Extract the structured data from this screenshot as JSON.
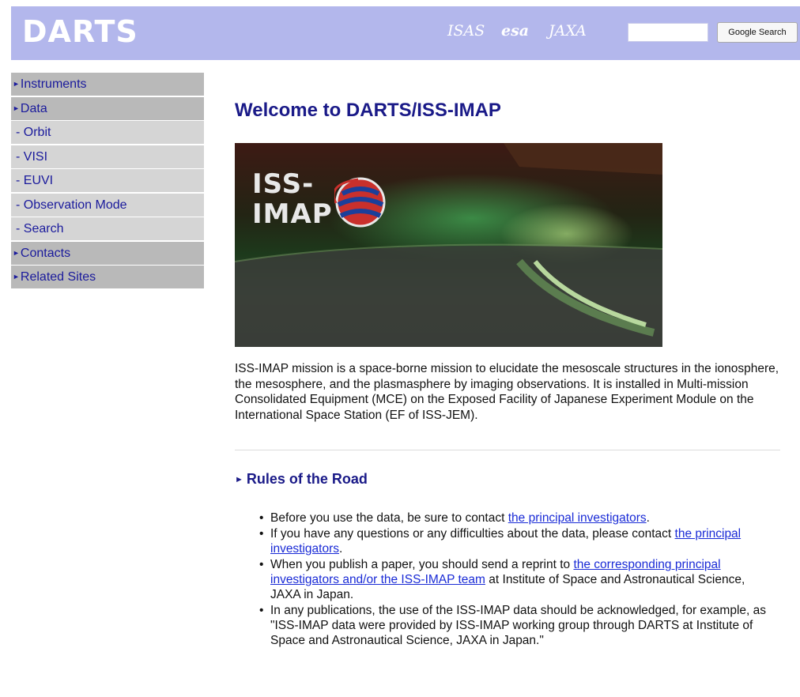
{
  "header": {
    "logo": "DARTS",
    "agencies": [
      "ISAS",
      "esa",
      "JAXA"
    ],
    "search_placeholder": "",
    "search_button": "Google Search"
  },
  "sidebar": {
    "items": [
      {
        "label": "Instruments",
        "type": "section"
      },
      {
        "label": "Data",
        "type": "section"
      },
      {
        "label": "- Orbit",
        "type": "sub"
      },
      {
        "label": "- VISI",
        "type": "sub"
      },
      {
        "label": "- EUVI",
        "type": "sub"
      },
      {
        "label": "- Observation Mode",
        "type": "sub"
      },
      {
        "label": "- Search",
        "type": "sub"
      },
      {
        "label": "Contacts",
        "type": "section"
      },
      {
        "label": "Related Sites",
        "type": "section"
      }
    ]
  },
  "main": {
    "title": "Welcome to DARTS/ISS-IMAP",
    "hero": {
      "logo_line1": "ISS-",
      "logo_line2": "IMAP"
    },
    "intro": "ISS-IMAP mission is a space-borne mission to elucidate the mesoscale structures in the ionosphere, the mesosphere, and the plasmasphere by imaging observations. It is installed in Multi-mission Consolidated Equipment (MCE) on the Exposed Facility of Japanese Experiment Module on the International Space Station (EF of ISS-JEM).",
    "rules_heading": "Rules of the Road",
    "rules": [
      {
        "pre": "Before you use the data, be sure to contact ",
        "link": "the principal investigators",
        "post": "."
      },
      {
        "pre": "If you have any questions or any difficulties about the data, please contact ",
        "link": "the principal investigators",
        "post": "."
      },
      {
        "pre": "When you publish a paper, you should send a reprint to ",
        "link": "the corresponding principal investigators and/or the ISS-IMAP team",
        "post": " at Institute of Space and Astronautical Science, JAXA in Japan."
      },
      {
        "pre": "In any publications, the use of the ISS-IMAP data should be acknowledged, for example, as \"ISS-IMAP data were provided by ISS-IMAP working group through DARTS at Institute of Space and Astronautical Science, JAXA in Japan.\"",
        "link": "",
        "post": ""
      }
    ]
  },
  "colors": {
    "header_bg": "#b3b7ec",
    "nav_section_bg": "#b9b9b9",
    "nav_sub_bg": "#d5d5d5",
    "link": "#1a2bd6",
    "title": "#1a1a88"
  }
}
